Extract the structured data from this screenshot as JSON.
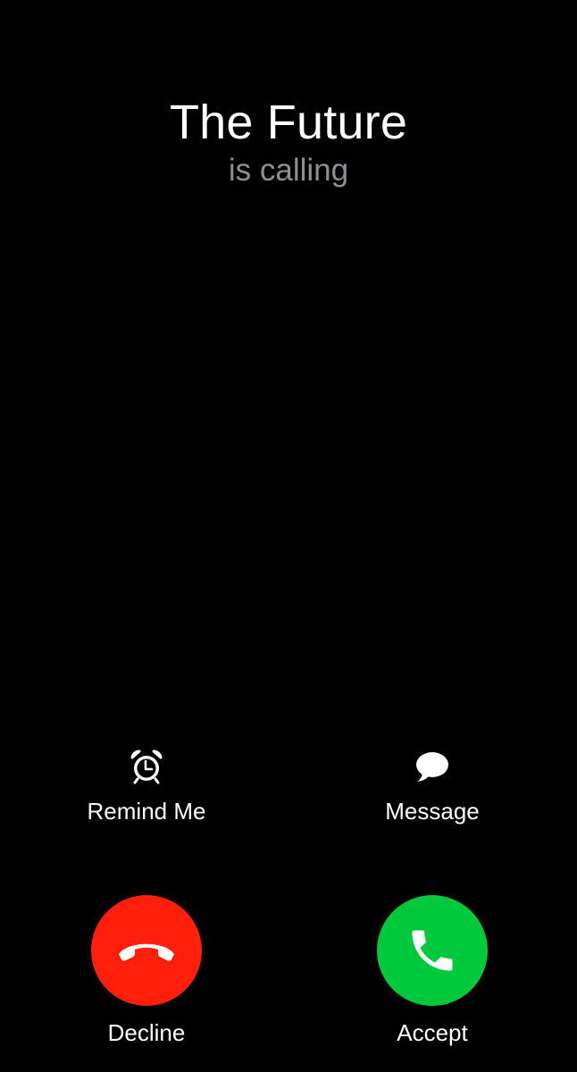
{
  "caller": {
    "name": "The Future",
    "status": "is calling"
  },
  "options": {
    "remind": {
      "label": "Remind Me",
      "icon": "alarm-clock-icon"
    },
    "message": {
      "label": "Message",
      "icon": "speech-bubble-icon"
    }
  },
  "actions": {
    "decline": {
      "label": "Decline",
      "icon": "phone-hangup-icon",
      "color": "#ff1f0a"
    },
    "accept": {
      "label": "Accept",
      "icon": "phone-icon",
      "color": "#00c93c"
    }
  },
  "theme": {
    "background": "#000000",
    "secondary_text": "#8e8e93"
  }
}
